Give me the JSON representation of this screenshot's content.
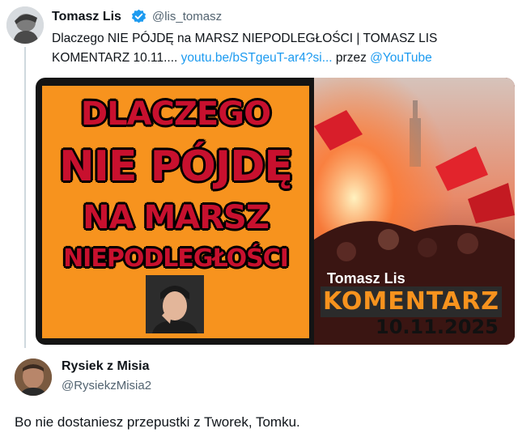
{
  "quoted_tweet": {
    "author_name": "Tomasz Lis",
    "verified_icon": "verified-badge-icon",
    "handle": "@lis_tomasz",
    "text_line1": "Dlaczego NIE PÓJDĘ na MARSZ NIEPODLEGŁOŚCI | TOMASZ LIS",
    "text_line2_prefix": "KOMENTARZ 10.11.... ",
    "link_text": "youtu.be/bSTgeuT-ar4?si...",
    "via_text": " przez ",
    "via_handle": "@YouTube",
    "thumbnail": {
      "title_lines": [
        "DLACZEGO",
        "NIE PÓJDĘ",
        "NA MARSZ",
        "NIEPODLEGŁOŚCI"
      ],
      "presenter_name": "Tomasz Lis",
      "segment_label": "KOMENTARZ",
      "date": "10.11.2025"
    }
  },
  "reply": {
    "author_name": "Rysiek z Misia",
    "handle": "@RysiekzMisia2",
    "text": "Bo nie dostaniesz przepustki z Tworek, Tomku."
  },
  "colors": {
    "link": "#1d9bf0",
    "thumbnail_orange": "#f7931e",
    "title_red": "#c8102e"
  }
}
